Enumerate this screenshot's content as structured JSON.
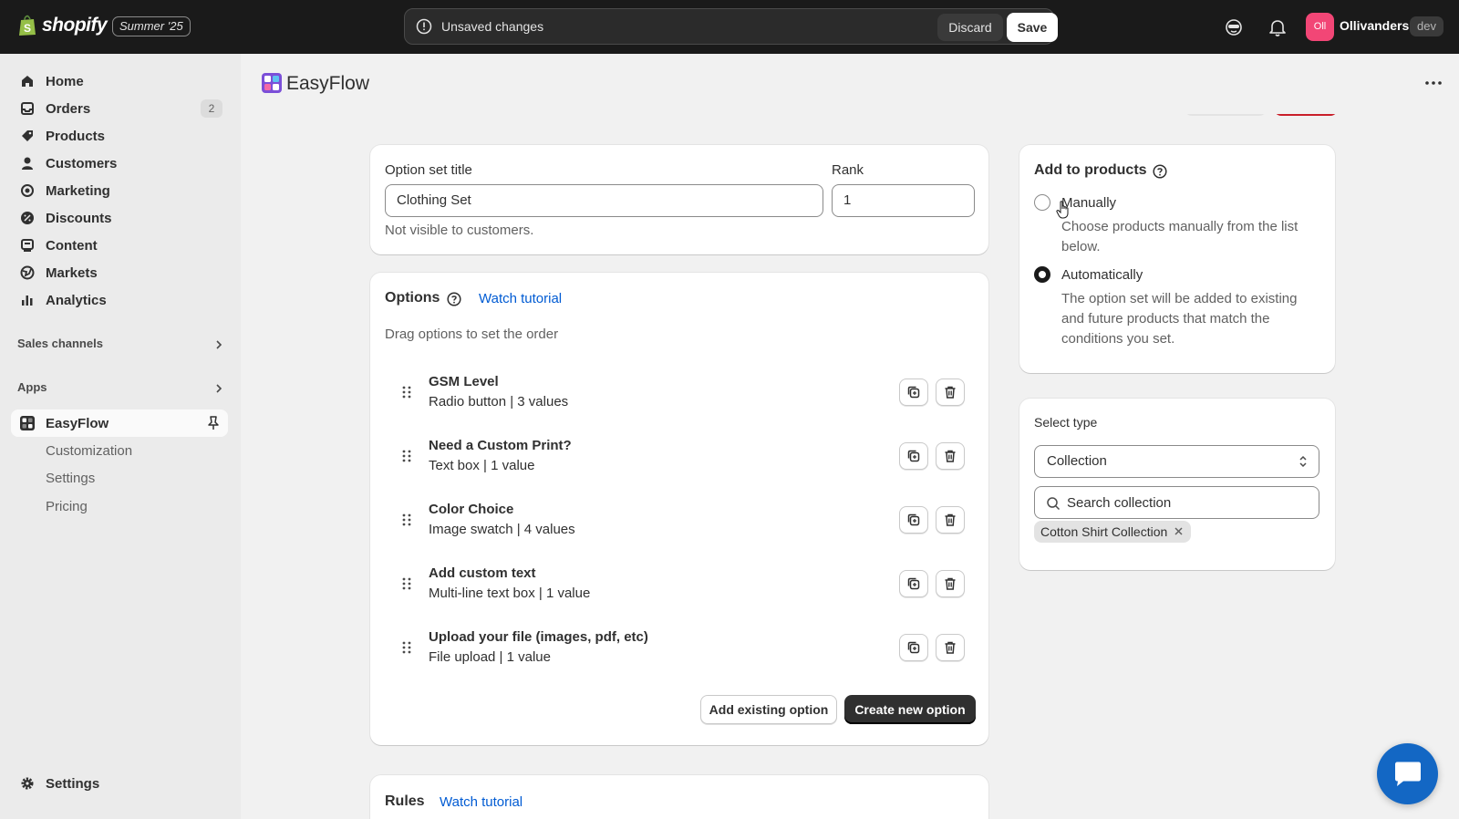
{
  "topbar": {
    "brand": "shopify",
    "edition": "Summer '25",
    "unsaved_text": "Unsaved changes",
    "discard_label": "Discard",
    "save_label": "Save",
    "store_initials": "Oll",
    "store_name": "Ollivanders",
    "store_tag": "dev"
  },
  "sidebar": {
    "items": [
      {
        "label": "Home",
        "icon": "home-icon"
      },
      {
        "label": "Orders",
        "icon": "orders-icon",
        "badge": "2"
      },
      {
        "label": "Products",
        "icon": "tag-icon"
      },
      {
        "label": "Customers",
        "icon": "person-icon"
      },
      {
        "label": "Marketing",
        "icon": "target-icon"
      },
      {
        "label": "Discounts",
        "icon": "discount-icon"
      },
      {
        "label": "Content",
        "icon": "content-icon"
      },
      {
        "label": "Markets",
        "icon": "globe-icon"
      },
      {
        "label": "Analytics",
        "icon": "bar-chart-icon"
      }
    ],
    "sales_channels": "Sales channels",
    "apps": "Apps",
    "app_name": "EasyFlow",
    "sub_items": [
      "Customization",
      "Settings",
      "Pricing"
    ],
    "settings": "Settings"
  },
  "app": {
    "title": "EasyFlow"
  },
  "option_set": {
    "title_label": "Option set title",
    "title_value": "Clothing Set",
    "rank_label": "Rank",
    "rank_value": "1",
    "help": "Not visible to customers."
  },
  "options": {
    "title": "Options",
    "tutorial_link": "Watch tutorial",
    "hint": "Drag options to set the order",
    "items": [
      {
        "name": "GSM Level",
        "desc": "Radio button | 3 values"
      },
      {
        "name": "Need a Custom Print?",
        "desc": "Text box | 1 value"
      },
      {
        "name": "Color Choice",
        "desc": "Image swatch | 4 values"
      },
      {
        "name": "Add custom text",
        "desc": "Multi-line text box | 1 value"
      },
      {
        "name": "Upload your file (images, pdf, etc)",
        "desc": "File upload | 1 value"
      }
    ],
    "add_existing": "Add existing option",
    "create_new": "Create new option"
  },
  "rules": {
    "title": "Rules",
    "tutorial_link": "Watch tutorial"
  },
  "add_to_products": {
    "title": "Add to products",
    "manual_label": "Manually",
    "manual_desc": "Choose products manually from the list below.",
    "auto_label": "Automatically",
    "auto_desc": "The option set will be added to existing and future products that match the conditions you set.",
    "selected": "Automatically"
  },
  "select_type": {
    "label": "Select type",
    "value": "Collection",
    "search_placeholder": "Search collection",
    "tags": [
      "Cotton Shirt Collection"
    ]
  },
  "colors": {
    "topbar": "#1a1a1a",
    "link": "#005bd3",
    "primary_button": "#303030",
    "store_avatar": "#f24676",
    "chat": "#1367c4"
  }
}
